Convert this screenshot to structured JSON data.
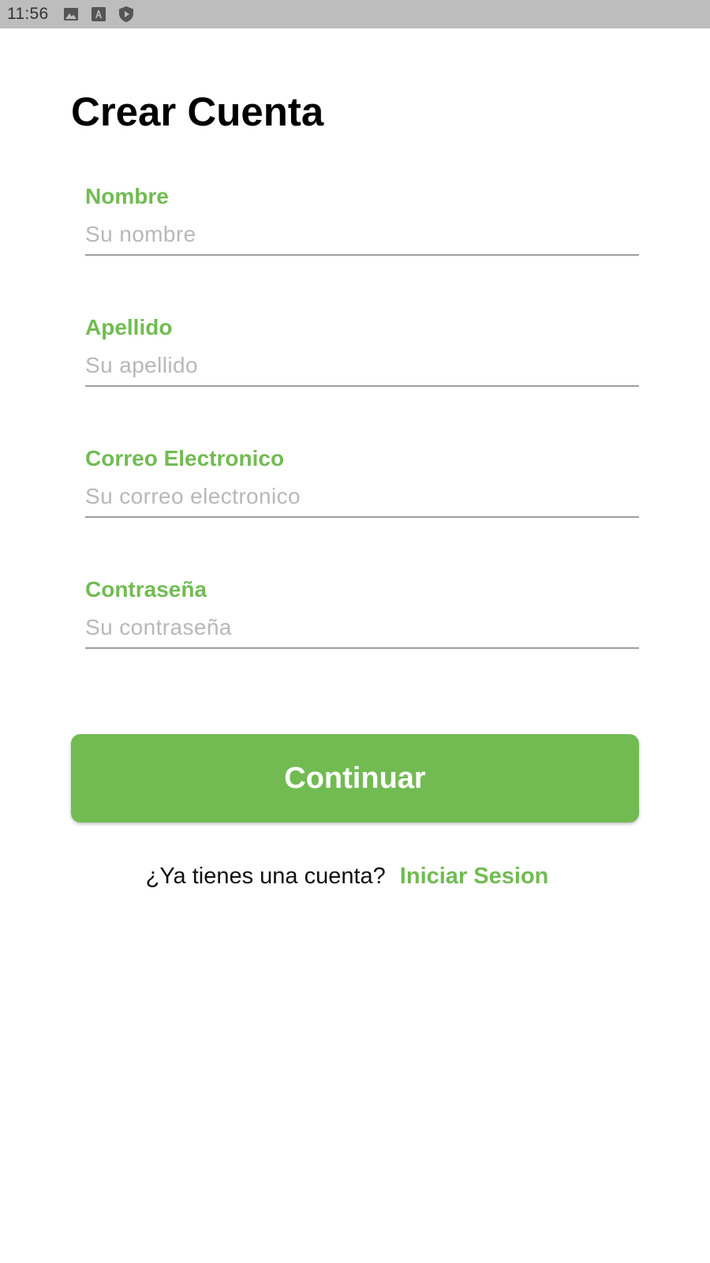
{
  "status_bar": {
    "time": "11:56",
    "icons": [
      "image-icon",
      "font-a-icon",
      "shield-play-icon"
    ]
  },
  "title": "Crear Cuenta",
  "form": {
    "fields": [
      {
        "label": "Nombre",
        "placeholder": "Su nombre",
        "value": ""
      },
      {
        "label": "Apellido",
        "placeholder": "Su apellido",
        "value": ""
      },
      {
        "label": "Correo Electronico",
        "placeholder": "Su correo electronico",
        "value": ""
      },
      {
        "label": "Contraseña",
        "placeholder": "Su contraseña",
        "value": ""
      }
    ]
  },
  "continue_label": "Continuar",
  "signin": {
    "question": "¿Ya tienes una cuenta?",
    "link": "Iniciar Sesion"
  },
  "colors": {
    "accent": "#72bb53",
    "status_bar": "#bdbdbd"
  }
}
